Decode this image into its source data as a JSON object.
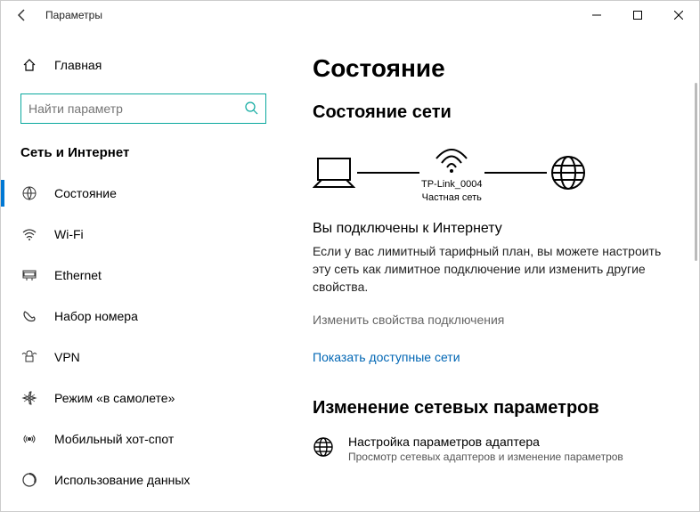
{
  "window": {
    "title": "Параметры"
  },
  "sidebar": {
    "home": "Главная",
    "search_placeholder": "Найти параметр",
    "category": "Сеть и Интернет",
    "items": [
      {
        "label": "Состояние"
      },
      {
        "label": "Wi-Fi"
      },
      {
        "label": "Ethernet"
      },
      {
        "label": "Набор номера"
      },
      {
        "label": "VPN"
      },
      {
        "label": "Режим «в самолете»"
      },
      {
        "label": "Мобильный хот-спот"
      },
      {
        "label": "Использование данных"
      }
    ]
  },
  "main": {
    "heading": "Состояние",
    "subheading": "Состояние сети",
    "connection_name": "TP-Link_0004",
    "connection_type": "Частная сеть",
    "connected_title": "Вы подключены к Интернету",
    "connected_body": "Если у вас лимитный тарифный план, вы можете настроить эту сеть как лимитное подключение или изменить другие свойства.",
    "change_props": "Изменить свойства подключения",
    "show_networks": "Показать доступные сети",
    "change_settings_heading": "Изменение сетевых параметров",
    "adapter_title": "Настройка параметров адаптера",
    "adapter_sub": "Просмотр сетевых адаптеров и изменение параметров"
  }
}
